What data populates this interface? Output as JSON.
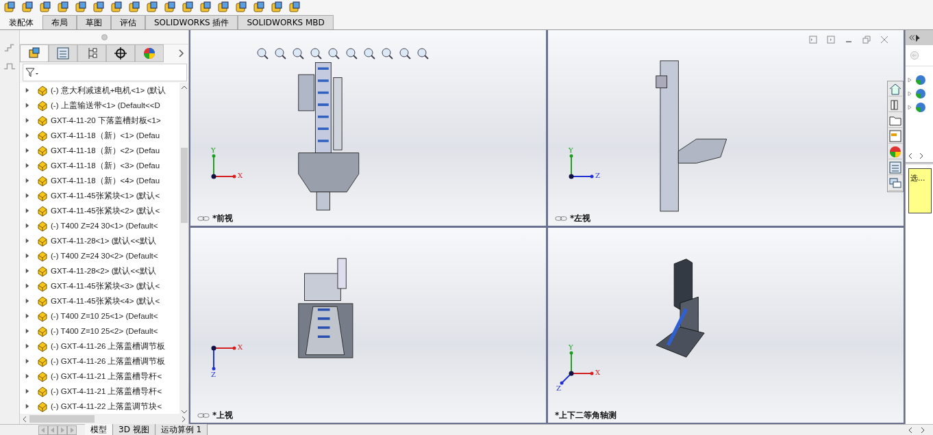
{
  "command_tabs": [
    {
      "label": "装配体",
      "selected": true
    },
    {
      "label": "布局",
      "selected": false
    },
    {
      "label": "草图",
      "selected": false
    },
    {
      "label": "评估",
      "selected": false
    },
    {
      "label": "SOLIDWORKS 插件",
      "selected": false
    },
    {
      "label": "SOLIDWORKS MBD",
      "selected": false
    }
  ],
  "feature_tree": {
    "items": [
      {
        "label": "(-) 意大利减速机+电机<1> (默认",
        "expanded": false
      },
      {
        "label": "(-) 上盖输送带<1> (Default<<D",
        "expanded": false
      },
      {
        "label": "GXT-4-11-20 下落盖槽封板<1>",
        "expanded": false
      },
      {
        "label": "GXT-4-11-18（新）<1> (Defau",
        "expanded": false
      },
      {
        "label": "GXT-4-11-18（新）<2> (Defau",
        "expanded": false
      },
      {
        "label": "GXT-4-11-18（新）<3> (Defau",
        "expanded": false
      },
      {
        "label": "GXT-4-11-18（新）<4> (Defau",
        "expanded": false
      },
      {
        "label": "GXT-4-11-45张紧块<1> (默认<",
        "expanded": false
      },
      {
        "label": "GXT-4-11-45张紧块<2> (默认<",
        "expanded": false
      },
      {
        "label": "(-) T400 Z=24 30<1> (Default<",
        "expanded": false
      },
      {
        "label": "GXT-4-11-28<1> (默认<<默认",
        "expanded": false
      },
      {
        "label": "(-) T400 Z=24 30<2> (Default<",
        "expanded": false
      },
      {
        "label": "GXT-4-11-28<2> (默认<<默认",
        "expanded": false
      },
      {
        "label": "GXT-4-11-45张紧块<3> (默认<",
        "expanded": false
      },
      {
        "label": "GXT-4-11-45张紧块<4> (默认<",
        "expanded": false
      },
      {
        "label": "(-) T400 Z=10 25<1> (Default<",
        "expanded": false
      },
      {
        "label": "(-) T400 Z=10 25<2> (Default<",
        "expanded": false
      },
      {
        "label": "(-) GXT-4-11-26 上落盖槽调节板",
        "expanded": false
      },
      {
        "label": "(-) GXT-4-11-26 上落盖槽调节板",
        "expanded": false
      },
      {
        "label": "(-) GXT-4-11-21 上落盖槽导杆<",
        "expanded": false
      },
      {
        "label": "(-) GXT-4-11-21 上落盖槽导杆<",
        "expanded": false
      },
      {
        "label": "(-) GXT-4-11-22 上落盖调节块<",
        "expanded": false
      }
    ]
  },
  "views": [
    {
      "kind": "front",
      "label": "*前视",
      "linked": true,
      "triad": [
        {
          "label": "Y",
          "kind": "up",
          "color": "#1f9e1f"
        },
        {
          "label": "X",
          "kind": "right",
          "color": "#d42020"
        }
      ]
    },
    {
      "kind": "side",
      "label": "*左视",
      "linked": true,
      "triad": [
        {
          "label": "Y",
          "kind": "up",
          "color": "#1f9e1f"
        },
        {
          "label": "Z",
          "kind": "right",
          "color": "#2030d0"
        }
      ]
    },
    {
      "kind": "top",
      "label": "*上视",
      "linked": true,
      "triad": [
        {
          "label": "X",
          "kind": "right",
          "color": "#d42020"
        },
        {
          "label": "Z",
          "kind": "down",
          "color": "#2030d0"
        }
      ]
    },
    {
      "kind": "iso",
      "label": "*上下二等角轴测",
      "linked": false,
      "triad": [
        {
          "label": "Y",
          "kind": "up",
          "color": "#1f9e1f"
        },
        {
          "label": "X",
          "kind": "right",
          "color": "#d42020"
        },
        {
          "label": "Z",
          "kind": "downleft",
          "color": "#2030d0"
        }
      ]
    }
  ],
  "task_pane": {
    "note": "选..."
  },
  "bottom_tabs": [
    {
      "label": "模型",
      "selected": true
    },
    {
      "label": "3D 视图",
      "selected": false
    },
    {
      "label": "运动算例 1",
      "selected": false
    }
  ]
}
